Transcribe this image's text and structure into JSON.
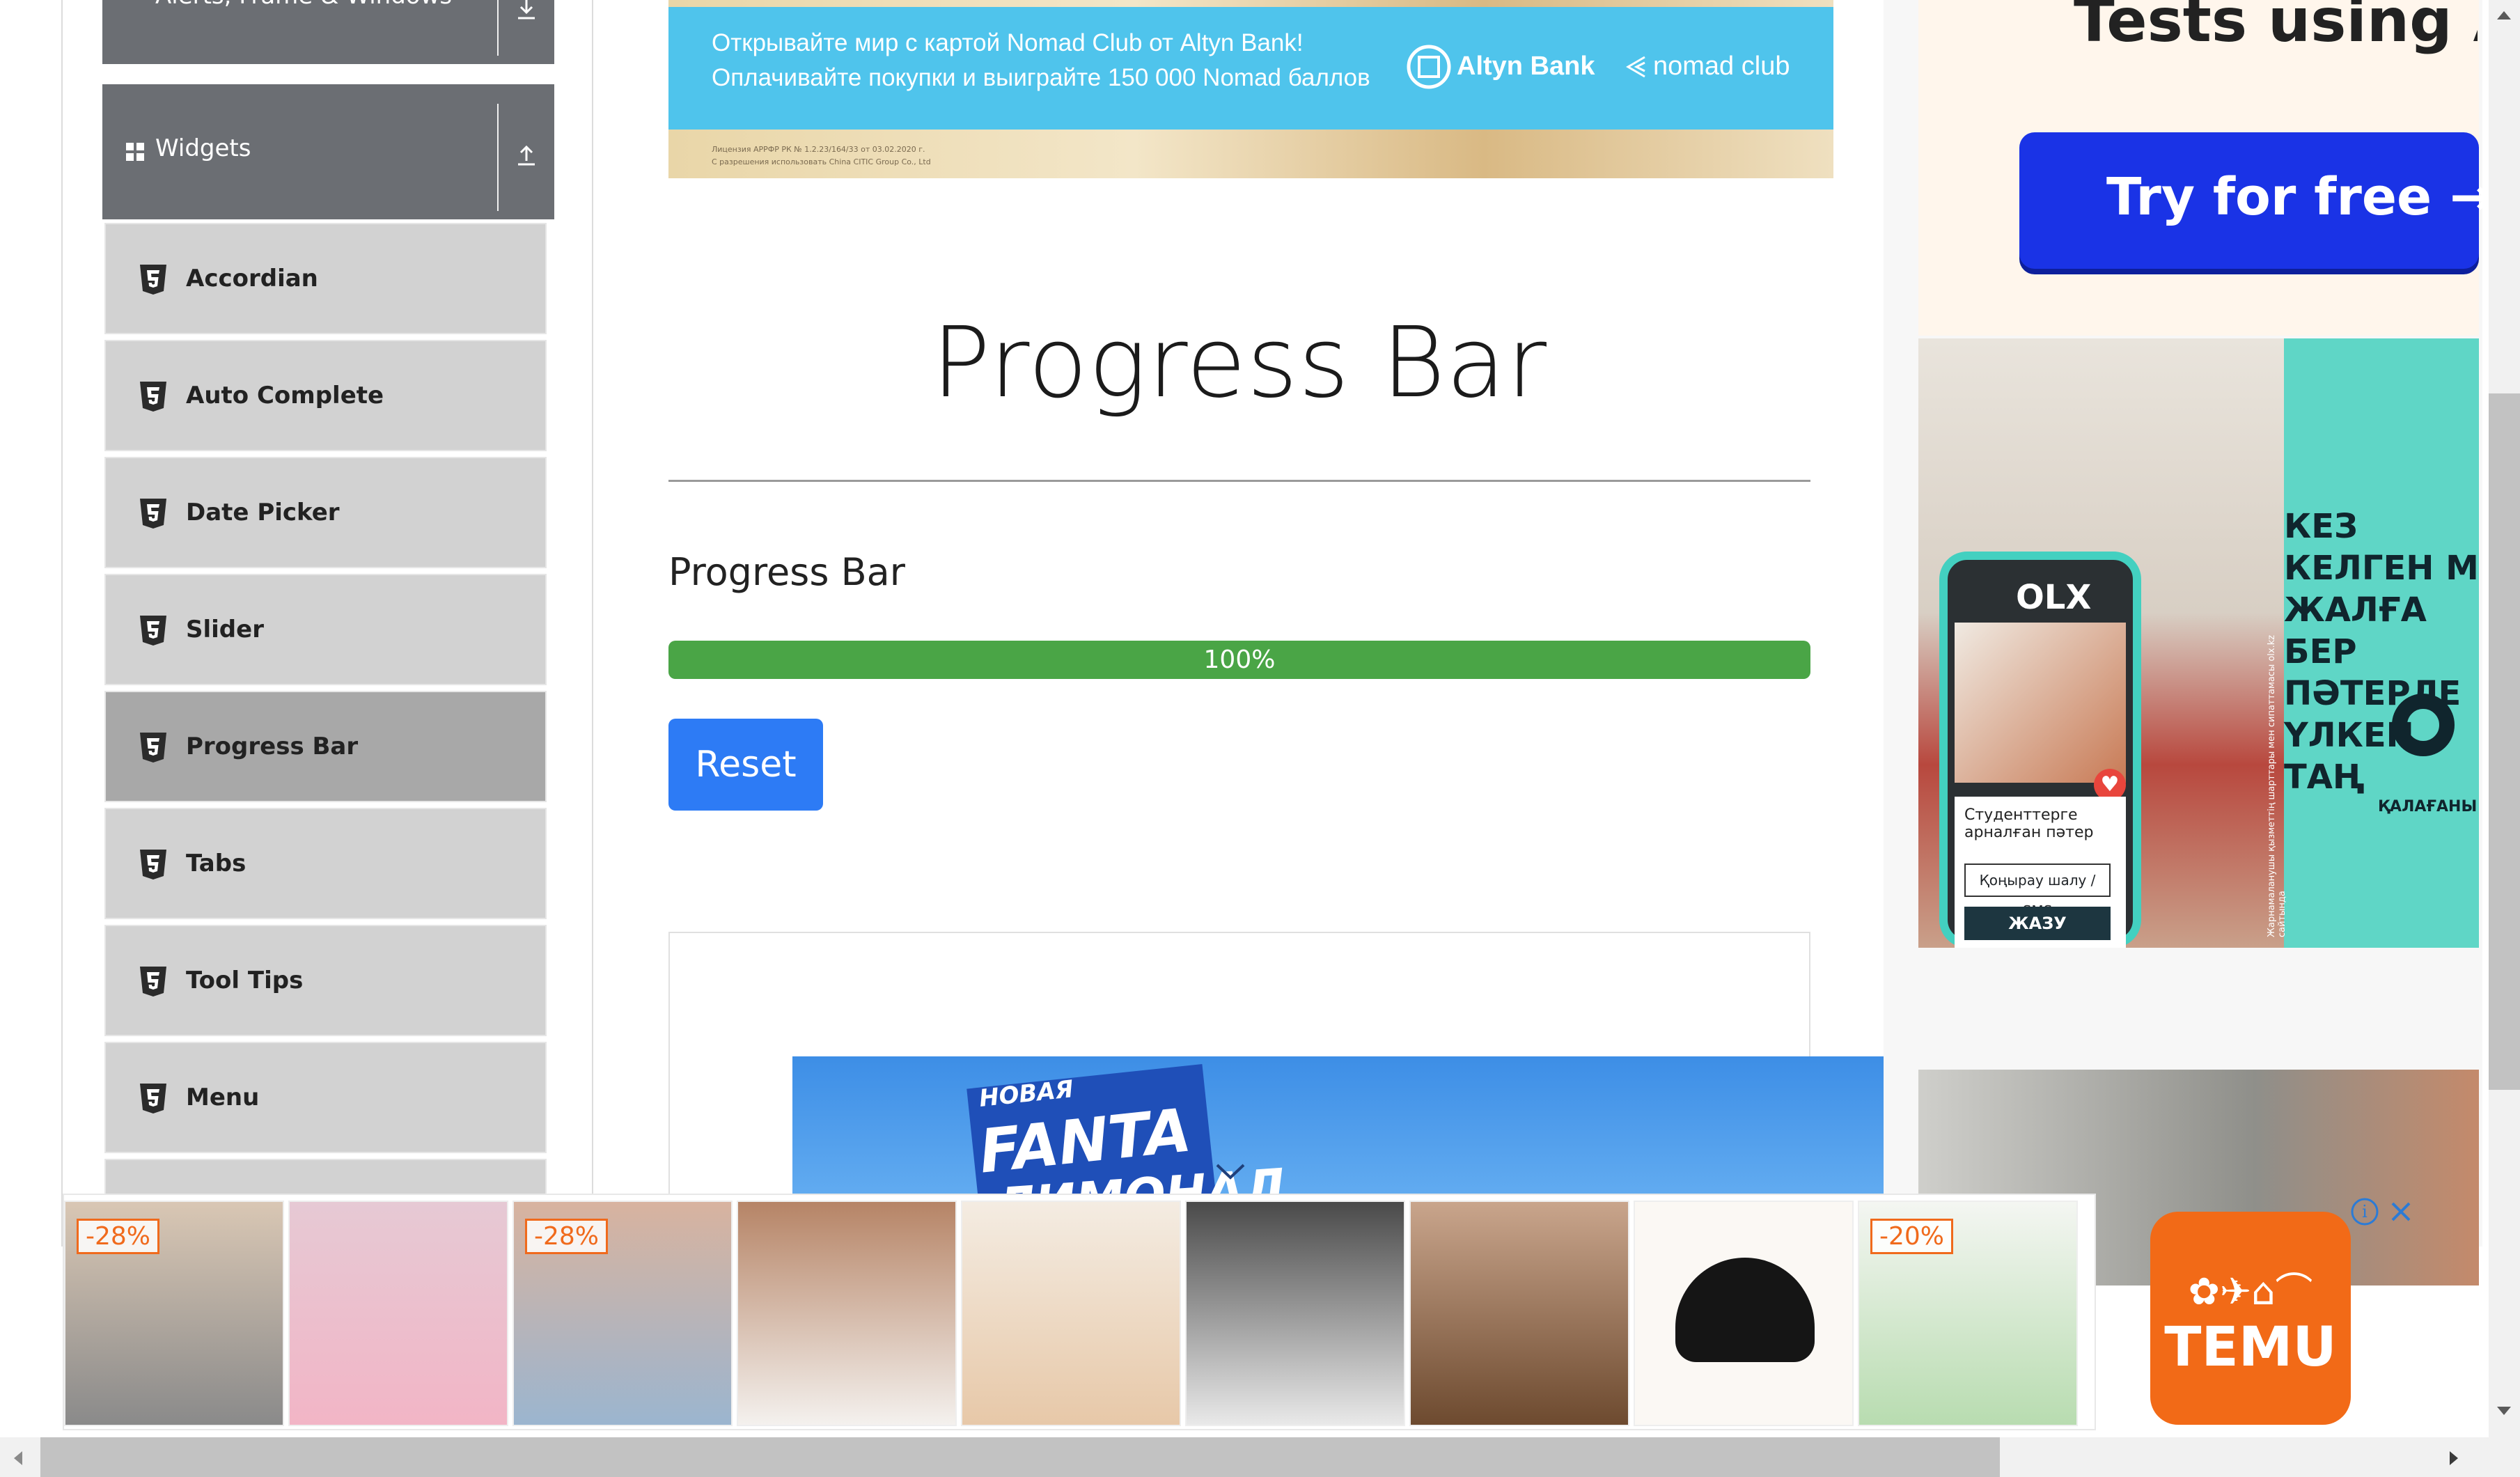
{
  "sidebar": {
    "group_top_label": "Alerts, Frame & Windows",
    "group_widgets_label": "Widgets",
    "items": [
      {
        "label": "Accordian"
      },
      {
        "label": "Auto Complete"
      },
      {
        "label": "Date Picker"
      },
      {
        "label": "Slider"
      },
      {
        "label": "Progress Bar",
        "active": true
      },
      {
        "label": "Tabs"
      },
      {
        "label": "Tool Tips"
      },
      {
        "label": "Menu"
      }
    ]
  },
  "top_banner": {
    "line1": "Открывайте мир с картой Nomad Club от Altyn Bank!",
    "line2": "Оплачивайте покупки и выиграйте 150 000 Nomad баллов",
    "brand1": "Altyn Bank",
    "brand2": "nomad club",
    "fineprint1": "Лицензия АРРФР РК № 1.2.23/164/33 от 03.02.2020 г.",
    "fineprint2": "С разрешения использовать China CITIC Group Co., Ltd"
  },
  "main": {
    "page_title": "Progress Bar",
    "section_label": "Progress Bar",
    "progress": {
      "value": 100,
      "text": "100%"
    },
    "reset_label": "Reset"
  },
  "inner_ad": {
    "line1": "НОВАЯ",
    "line2": "FANTA",
    "line3": "ЛИМОНАД"
  },
  "right_ads": {
    "top_text": "Tests using A",
    "try_label": "Try for free →",
    "olx_big_text": [
      "КЕЗ КЕЛГЕН М",
      "ЖАЛҒА БЕР",
      "ПӘТЕРЛЕ",
      "ҮЛКЕН ТАҢ"
    ],
    "olx_brand": "OLX",
    "olx_caption": "ҚАЛАҒАНЫ",
    "phone_caption": "Студенттерге арналған пәтер",
    "phone_btn1": "Қоңырау шалу / SMS",
    "phone_btn2": "ЖАЗУ",
    "olx_vertical": "Жарнамаланушы қызметтің шарттары мен сипаттамасы olx.kz сайтында"
  },
  "bottom_ads": {
    "discounts": [
      "-28%",
      "-28%",
      "-20%"
    ],
    "brand": "TEMU",
    "info_icon": "info-icon",
    "close_icon": "close-icon"
  },
  "colors": {
    "sidebar_group": "#6b6e73",
    "menu_item": "#d2d2d2",
    "menu_item_active": "#a8a8a8",
    "progress_fill": "#4aa546",
    "reset_button": "#2d7bf5",
    "temu_orange": "#f26a17"
  }
}
